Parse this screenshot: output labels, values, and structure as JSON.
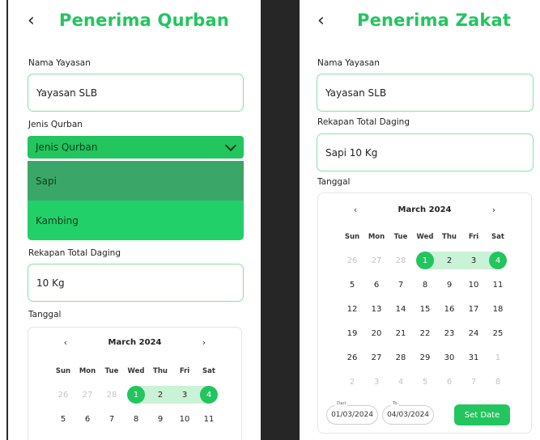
{
  "left": {
    "back_glyph": "‹",
    "title": "Penerima Qurban",
    "nama_label": "Nama Yayasan",
    "nama_value": "Yayasan SLB",
    "jenis_label": "Jenis Qurban",
    "jenis_selected": "Jenis Qurban",
    "jenis_options": [
      "Sapi",
      "Kambing"
    ],
    "rekapan_label": "Rekapan Total Daging",
    "rekapan_value": "10 Kg",
    "tanggal_label": "Tanggal",
    "calendar": {
      "month": "March 2024",
      "prev": "‹",
      "next": "›",
      "weekdays": [
        "Sun",
        "Mon",
        "Tue",
        "Wed",
        "Thu",
        "Fri",
        "Sat"
      ],
      "rows": [
        [
          "26",
          "27",
          "28",
          "1",
          "2",
          "3",
          "4"
        ],
        [
          "5",
          "6",
          "7",
          "8",
          "9",
          "10",
          "11"
        ]
      ]
    }
  },
  "right": {
    "back_glyph": "‹",
    "title": "Penerima Zakat",
    "nama_label": "Nama Yayasan",
    "nama_value": "Yayasan SLB",
    "rekapan_label": "Rekapan Total Daging",
    "rekapan_value": "Sapi 10 Kg",
    "tanggal_label": "Tanggal",
    "calendar": {
      "month": "March 2024",
      "prev": "‹",
      "next": "›",
      "weekdays": [
        "Sun",
        "Mon",
        "Tue",
        "Wed",
        "Thu",
        "Fri",
        "Sat"
      ],
      "rows": [
        [
          "26",
          "27",
          "28",
          "1",
          "2",
          "3",
          "4"
        ],
        [
          "5",
          "6",
          "7",
          "8",
          "9",
          "10",
          "11"
        ],
        [
          "12",
          "13",
          "14",
          "15",
          "16",
          "17",
          "18"
        ],
        [
          "19",
          "20",
          "21",
          "22",
          "23",
          "24",
          "25"
        ],
        [
          "26",
          "27",
          "28",
          "29",
          "30",
          "31",
          "1"
        ],
        [
          "2",
          "3",
          "4",
          "5",
          "6",
          "7",
          "8"
        ]
      ]
    },
    "from_caption": "Dari",
    "from_value": "01/03/2024",
    "to_caption": "To",
    "to_value": "04/03/2024",
    "set_date": "Set Date"
  },
  "colors": {
    "accent": "#22c55e",
    "range": "#c9f2d6",
    "hover": "#3aa769",
    "divider": "#262626"
  }
}
